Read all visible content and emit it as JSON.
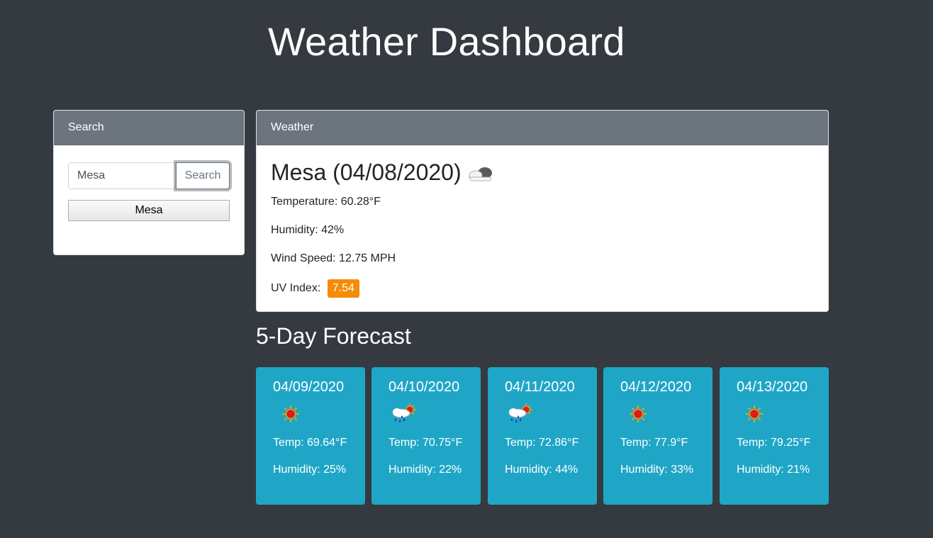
{
  "page": {
    "title": "Weather Dashboard"
  },
  "search": {
    "header": "Search",
    "input_value": "Mesa",
    "button_label": "Search",
    "history": [
      "Mesa"
    ]
  },
  "weather": {
    "header": "Weather",
    "city_date": "Mesa (04/08/2020)",
    "icon": "cloud-icon",
    "temperature": "Temperature: 60.28°F",
    "humidity": "Humidity: 42%",
    "wind": "Wind Speed: 12.75 MPH",
    "uv_label": "UV Index:",
    "uv_value": "7.54",
    "uv_color": "#f48c06"
  },
  "forecast": {
    "title": "5-Day Forecast",
    "days": [
      {
        "date": "04/09/2020",
        "icon": "sun-icon",
        "temp": "Temp: 69.64°F",
        "humidity": "Humidity: 25%"
      },
      {
        "date": "04/10/2020",
        "icon": "rain-sun-icon",
        "temp": "Temp: 70.75°F",
        "humidity": "Humidity: 22%"
      },
      {
        "date": "04/11/2020",
        "icon": "rain-sun-icon",
        "temp": "Temp: 72.86°F",
        "humidity": "Humidity: 44%"
      },
      {
        "date": "04/12/2020",
        "icon": "sun-icon",
        "temp": "Temp: 77.9°F",
        "humidity": "Humidity: 33%"
      },
      {
        "date": "04/13/2020",
        "icon": "sun-icon",
        "temp": "Temp: 79.25°F",
        "humidity": "Humidity: 21%"
      }
    ]
  }
}
